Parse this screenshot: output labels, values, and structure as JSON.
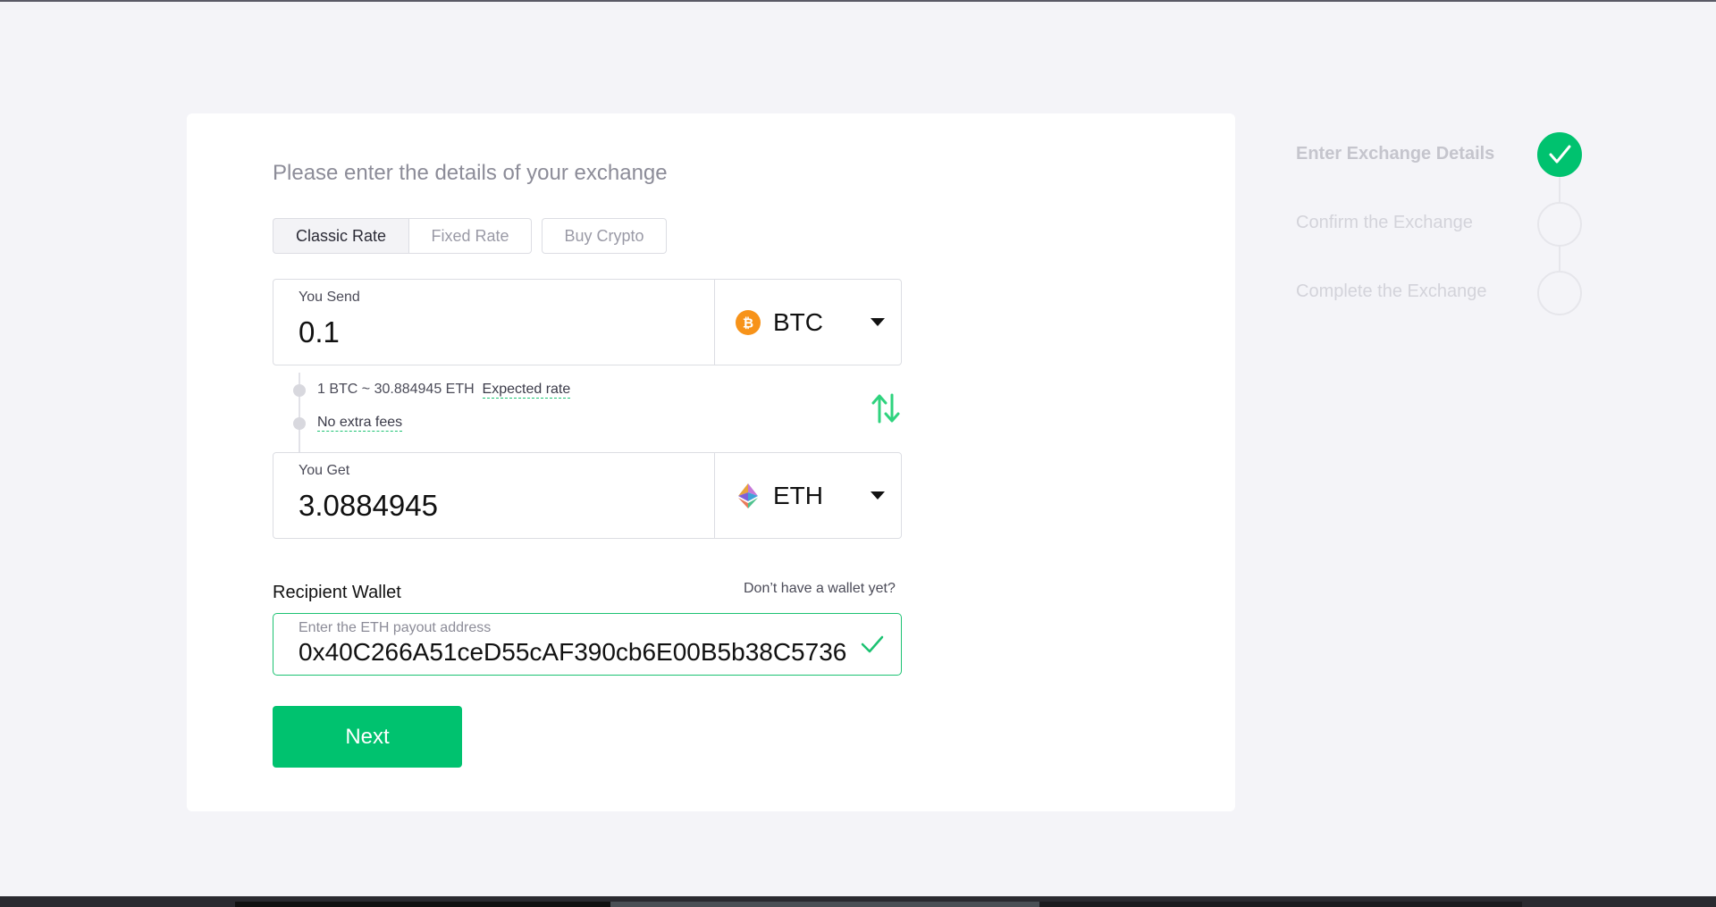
{
  "heading": "Please enter the details of your exchange",
  "tabs": [
    {
      "label": "Classic Rate",
      "active": true
    },
    {
      "label": "Fixed Rate",
      "active": false
    },
    {
      "label": "Buy Crypto",
      "active": false
    }
  ],
  "send": {
    "label": "You Send",
    "amount": "0.1",
    "currency": "BTC",
    "icon": "bitcoin-icon"
  },
  "rate": {
    "text": "1 BTC ~ 30.884945 ETH",
    "expected_label": "Expected rate",
    "fees_label": "No extra fees"
  },
  "get": {
    "label": "You Get",
    "amount": "3.0884945",
    "currency": "ETH",
    "icon": "ethereum-icon"
  },
  "wallet": {
    "label": "Recipient Wallet",
    "help_link": "Don’t have a wallet yet?",
    "placeholder": "Enter the ETH payout address",
    "address": "0x40C266A51ceD55cAF390cb6E00B5b38C5736"
  },
  "next_label": "Next",
  "steps": [
    {
      "label": "Enter Exchange Details",
      "done": true
    },
    {
      "label": "Confirm the Exchange",
      "done": false
    },
    {
      "label": "Complete the Exchange",
      "done": false
    }
  ],
  "colors": {
    "accent": "#00c26f",
    "bitcoin": "#f7931a",
    "background": "#f4f4f8"
  }
}
